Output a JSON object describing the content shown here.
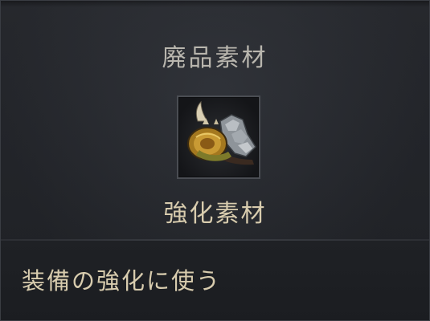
{
  "tooltip": {
    "category": "廃品素材",
    "item_name": "強化素材",
    "description": "装備の強化に使う",
    "icon": "salvage-material-icon",
    "colors": {
      "category_text": "#b9b6ae",
      "name_text": "#d8ccae",
      "description_text": "#d8ccae",
      "background": "#222429"
    }
  }
}
